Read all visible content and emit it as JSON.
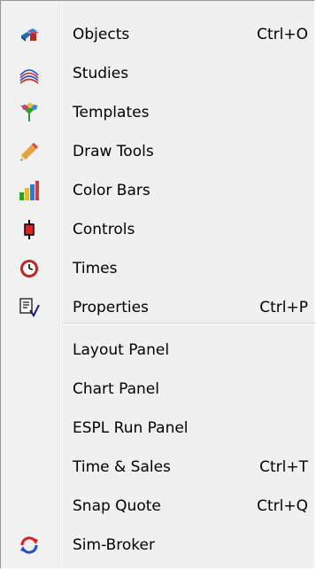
{
  "menu": {
    "items": [
      {
        "label": "Objects",
        "shortcut": "Ctrl+O",
        "icon": "objects-icon"
      },
      {
        "label": "Studies",
        "shortcut": "",
        "icon": "studies-icon"
      },
      {
        "label": "Templates",
        "shortcut": "",
        "icon": "templates-icon"
      },
      {
        "label": "Draw Tools",
        "shortcut": "",
        "icon": "pencil-icon"
      },
      {
        "label": "Color Bars",
        "shortcut": "",
        "icon": "color-bars-icon"
      },
      {
        "label": "Controls",
        "shortcut": "",
        "icon": "controls-icon"
      },
      {
        "label": "Times",
        "shortcut": "",
        "icon": "clock-icon"
      },
      {
        "label": "Properties",
        "shortcut": "Ctrl+P",
        "icon": "properties-icon"
      },
      {
        "label": "Layout Panel",
        "shortcut": ""
      },
      {
        "label": "Chart Panel",
        "shortcut": ""
      },
      {
        "label": "ESPL Run Panel",
        "shortcut": ""
      },
      {
        "label": "Time & Sales",
        "shortcut": "Ctrl+T"
      },
      {
        "label": "Snap Quote",
        "shortcut": "Ctrl+Q"
      },
      {
        "label": "Sim-Broker",
        "shortcut": "",
        "icon": "refresh-icon"
      }
    ]
  },
  "colors": {
    "menu_background": "#f0f0f0",
    "border": "#979797",
    "separator": "#d4d4d4"
  }
}
